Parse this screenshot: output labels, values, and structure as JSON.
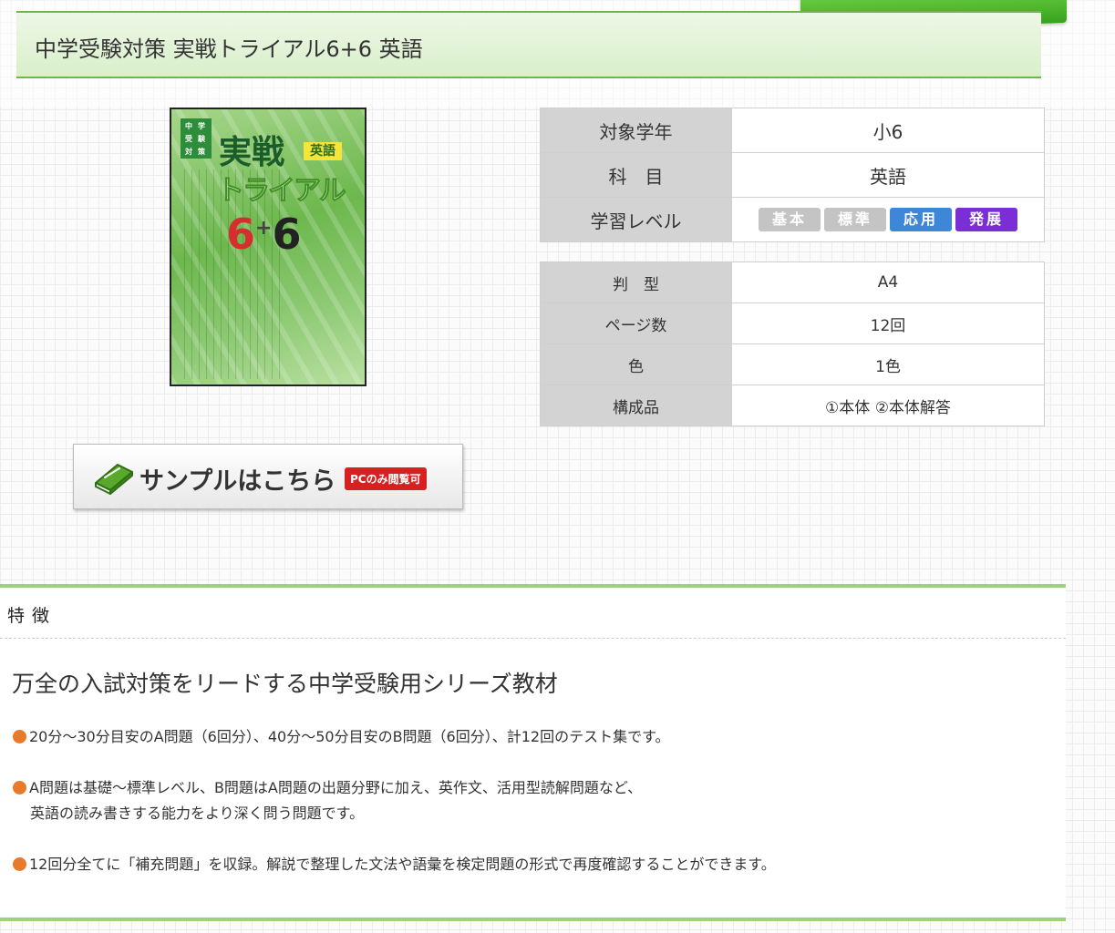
{
  "page": {
    "title": "中学受験対策 実戦トライアル6+6 英語"
  },
  "cover": {
    "box_text": [
      "中",
      "学",
      "受",
      "験",
      "対",
      "策"
    ],
    "title_line1": "実戦",
    "badge": "英語",
    "title_line2": "トライアル",
    "num1": "6",
    "plus": "+",
    "num2": "6"
  },
  "spec1": [
    {
      "label": "対象学年",
      "value": "小6"
    },
    {
      "label": "科　目",
      "value": "英語"
    },
    {
      "label": "学習レベル"
    }
  ],
  "levels": [
    {
      "label": "基本",
      "color": "#c4c4c4"
    },
    {
      "label": "標準",
      "color": "#c4c4c4"
    },
    {
      "label": "応用",
      "color": "#3e86d8"
    },
    {
      "label": "発展",
      "color": "#7a2fd6"
    }
  ],
  "spec2": [
    {
      "label": "判　型",
      "value": "A4"
    },
    {
      "label": "ページ数",
      "value": "12回"
    },
    {
      "label": "色",
      "value": "1色"
    },
    {
      "label": "構成品",
      "value": "①本体 ②本体解答"
    }
  ],
  "sample": {
    "label": "サンプルはこちら",
    "badge": "PCのみ閲覧可"
  },
  "features": {
    "title": "特徴",
    "headline": "万全の入試対策をリードする中学受験用シリーズ教材",
    "bullets": [
      {
        "lines": [
          "20分〜30分目安のA問題（6回分）、40分〜50分目安のB問題（6回分）、計12回のテスト集です。"
        ]
      },
      {
        "lines": [
          "A問題は基礎〜標準レベル、B問題はA問題の出題分野に加え、英作文、活用型読解問題など、",
          "英語の読み書きする能力をより深く問う問題です。"
        ]
      },
      {
        "lines": [
          "12回分全てに「補充問題」を収録。解説で整理した文法や語彙を検定問題の形式で再度確認することができます。"
        ]
      }
    ]
  },
  "colors": {
    "accent": "#6fb64a",
    "bullet": "#e87a2c",
    "badge_red": "#d7201f"
  }
}
